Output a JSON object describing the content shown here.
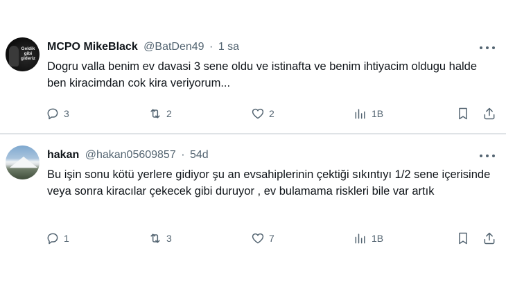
{
  "tweets": [
    {
      "display_name": "MCPO MikeBlack",
      "handle": "@BatDen49",
      "separator": "·",
      "time": "1 sa",
      "avatar_text": "Geldik gibi gideriz",
      "text": "Dogru valla benim ev davasi 3 sene oldu ve istinafta ve benim ihtiyacim oldugu halde ben kiracimdan cok kira veriyorum...",
      "replies": "3",
      "reposts": "2",
      "likes": "2",
      "views": "1B"
    },
    {
      "display_name": "hakan",
      "handle": "@hakan05609857",
      "separator": "·",
      "time": "54d",
      "text": "Bu işin sonu kötü yerlere gidiyor şu an evsahiplerinin çektiği sıkıntıyı 1/2 sene içerisinde veya sonra  kiracılar çekecek gibi duruyor , ev bulamama riskleri bile var artık",
      "replies": "1",
      "reposts": "3",
      "likes": "7",
      "views": "1B"
    }
  ],
  "icons": {
    "reply": "reply-icon",
    "repost": "repost-icon",
    "like": "heart-icon",
    "views": "views-icon",
    "bookmark": "bookmark-icon",
    "share": "share-icon",
    "more": "more-icon"
  },
  "colors": {
    "text": "#0f1419",
    "secondary": "#536471",
    "separator": "#dfe3e6",
    "background": "#ffffff"
  }
}
